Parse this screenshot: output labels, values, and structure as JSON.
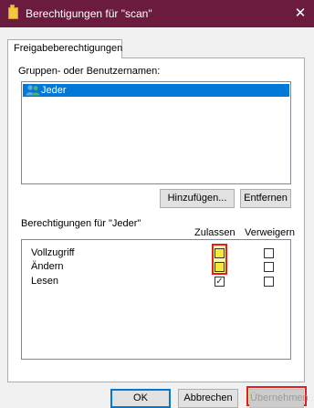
{
  "window": {
    "title": "Berechtigungen für \"scan\"",
    "close_glyph": "✕",
    "icon": "folder-icon"
  },
  "tabs": [
    {
      "label": "Freigabeberechtigungen",
      "selected": true
    }
  ],
  "groups": {
    "label": "Gruppen- oder Benutzernamen:",
    "items": [
      {
        "label": "Jeder",
        "icon": "users-icon",
        "selected": true
      }
    ]
  },
  "group_buttons": {
    "add": "Hinzufügen...",
    "remove": "Entfernen"
  },
  "permissions": {
    "label": "Berechtigungen für \"Jeder\"",
    "col_allow": "Zulassen",
    "col_deny": "Verweigern",
    "rows": [
      {
        "name": "Vollzugriff",
        "allow": false,
        "deny": false,
        "allow_highlighted": true
      },
      {
        "name": "Ändern",
        "allow": false,
        "deny": false,
        "allow_highlighted": true
      },
      {
        "name": "Lesen",
        "allow": true,
        "deny": false,
        "allow_highlighted": false
      }
    ],
    "check_glyph": "✓"
  },
  "footer": {
    "ok": "OK",
    "cancel": "Abbrechen",
    "apply": "Übernehmen"
  },
  "colors": {
    "titlebar": "#6b1b3d",
    "selection": "#0078d7",
    "highlight_fill": "#f6e83a",
    "highlight_border": "#e02020"
  }
}
